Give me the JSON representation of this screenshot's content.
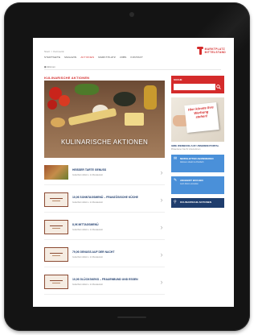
{
  "header": {
    "breadcrumb": "Start > Kulinarik",
    "nav": [
      "Startseite",
      "Magazin",
      "Aktionen",
      "Marktplatz",
      "Jobs",
      "Kontakt"
    ],
    "active_nav_index": 2,
    "logo_line1": "MARKTPLATZ",
    "logo_line2": "MITTELSTAND",
    "subnav": "◼ Aktionen"
  },
  "main": {
    "section_title": "Kulinarische Aktionen",
    "hero_caption": "Kulinarische Aktionen",
    "items": [
      {
        "title": "Heisser Tarte Genuss",
        "sub": "Gutschein Aktion • im Restaurant",
        "thumb": "food"
      },
      {
        "title": "10,0€ Sonntagsmenü – französische Küche",
        "sub": "Gutschein Aktion • im Restaurant",
        "thumb": "menu"
      },
      {
        "title": "8,0€ Mittagsmenü",
        "sub": "Gutschein Aktion • im Restaurant",
        "thumb": "menu"
      },
      {
        "title": "79,0€ Genuss auf der Nacht",
        "sub": "Gutschein Aktion • im Restaurant",
        "thumb": "menu"
      },
      {
        "title": "10,0€ Glückskeks – Frauenbund und Essen",
        "sub": "Gutschein Aktion • im Restaurant",
        "thumb": "menu"
      }
    ]
  },
  "sidebar": {
    "search_label": "Suche",
    "search_placeholder": "",
    "ad_board_text": "Hier könnte Ihre Werbung stehen!",
    "ad_caption": "Ihre Werbung auf unserem Portal",
    "ad_desc": "Präsentieren Sie Ihr Unternehmen",
    "promos": [
      {
        "title": "Newsletter abonnieren",
        "text": "Aktionen direkt ins Postfach",
        "style": "light",
        "icon": "envelope-icon"
      },
      {
        "title": "Angebot buchen",
        "text": "Jetzt Aktion einstellen",
        "style": "light",
        "icon": "pencil-icon"
      },
      {
        "title": "Kulinarische Aktionen",
        "text": "",
        "style": "dark",
        "icon": "fork-icon"
      }
    ]
  },
  "colors": {
    "accent": "#d42b2b",
    "title_blue": "#1f3d6d",
    "promo_blue": "#4a90d9"
  }
}
